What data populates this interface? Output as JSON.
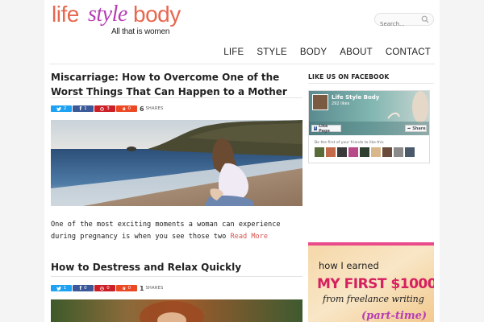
{
  "brand": {
    "word1": "life",
    "word2": "style",
    "word3": "body",
    "tagline": "All that is women"
  },
  "search": {
    "placeholder": "Search..."
  },
  "nav": [
    "LIFE",
    "STYLE",
    "BODY",
    "ABOUT",
    "CONTACT"
  ],
  "posts": [
    {
      "title": "Miscarriage: How to Overcome One of the Worst Things That Can Happen to a Mother",
      "share_counts": {
        "twitter": "2",
        "facebook": "1",
        "pinterest": "3",
        "stumbleupon": "0"
      },
      "total_shares": "6",
      "shares_label": "SHARES",
      "excerpt": "One of the most exciting moments a woman can experience during pregnancy is when you see those two",
      "read_more": "Read More"
    },
    {
      "title": "How to Destress and Relax Quickly",
      "share_counts": {
        "twitter": "1",
        "facebook": "0",
        "pinterest": "0",
        "stumbleupon": "0"
      },
      "total_shares": "1",
      "shares_label": "SHARES"
    }
  ],
  "sidebar": {
    "facebook_heading": "LIKE US ON FACEBOOK",
    "fb_page_name": "Life Style Body",
    "fb_likes": "292 likes",
    "fb_like_button": "Like Page",
    "fb_share_button": "Share",
    "fb_friends_text": "Be the first of your friends to like this"
  },
  "ad": {
    "line1": "how I earned",
    "line2": "MY FIRST $1000",
    "line3": "from freelance writing",
    "line4": "(part-time)"
  },
  "colors": {
    "accent": "#d9534f",
    "logo_coral": "#e8674f",
    "logo_purple": "#b63db6",
    "twitter": "#1da1f2",
    "facebook": "#3b5998",
    "pinterest": "#cb2027",
    "stumbleupon": "#eb4924"
  }
}
